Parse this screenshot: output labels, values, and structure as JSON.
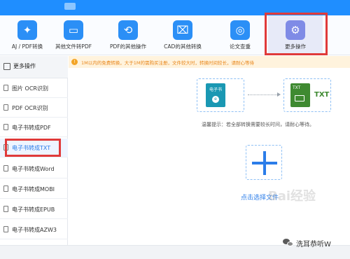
{
  "tools": [
    {
      "label": "AJ / PDF转换",
      "icon": "pdf-convert-icon"
    },
    {
      "label": "其他文件转PDF",
      "icon": "folder-icon"
    },
    {
      "label": "PDF的其他操作",
      "icon": "pdf-ops-icon"
    },
    {
      "label": "CAD的其他转换",
      "icon": "cad-icon"
    },
    {
      "label": "论文查重",
      "icon": "paper-check-icon"
    },
    {
      "label": "更多操作",
      "icon": "gear-icon"
    }
  ],
  "sidebar": {
    "header": "更多操作",
    "items": [
      {
        "label": "图片 OCR识别"
      },
      {
        "label": "PDF OCR识别"
      },
      {
        "label": "电子书转成PDF"
      },
      {
        "label": "电子书转成TXT"
      },
      {
        "label": "电子书转成Word"
      },
      {
        "label": "电子书转成MOBI"
      },
      {
        "label": "电子书转成EPUB"
      },
      {
        "label": "电子书转成AZW3"
      }
    ]
  },
  "notice": {
    "text": "1M以内的免费转换，大于1M的需购买注册，文件较大时，转换时间较长，请耐心等待"
  },
  "flow": {
    "source_label": "电子书",
    "target_label": "TXT",
    "target_big": "TXT"
  },
  "tip": "温馨提示：若全部转换需要较长时间，请耐心等待。",
  "upload": {
    "label": "点击选择文件"
  },
  "watermark": "Bai经验",
  "wechat_name": "洗耳恭听W"
}
